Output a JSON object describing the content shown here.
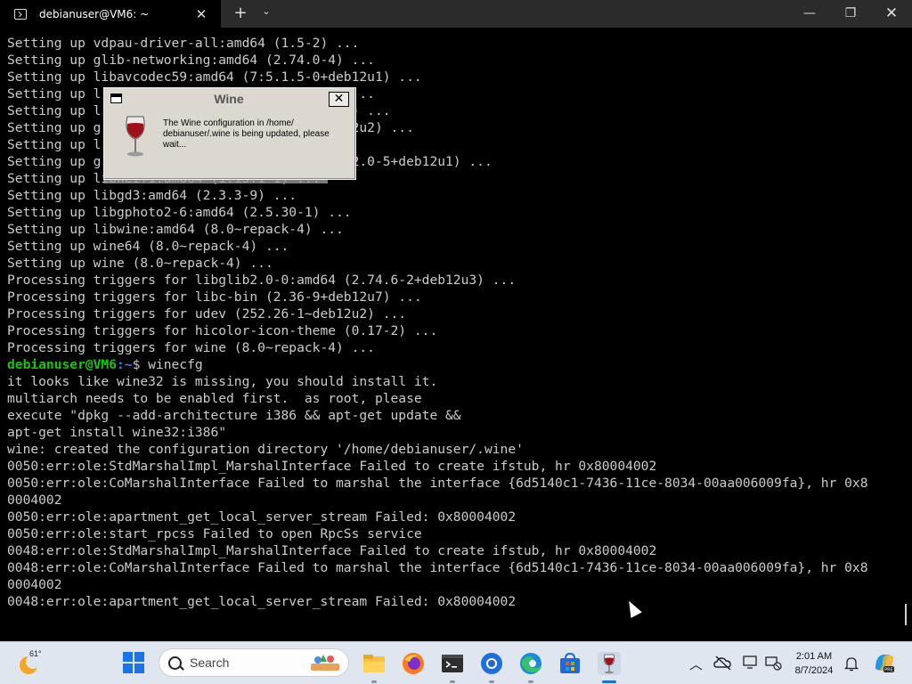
{
  "window": {
    "tab_title": "debianuser@VM6: ~",
    "tab_close": "✕",
    "new_tab": "+",
    "dropdown": "⌄",
    "minimize": "—",
    "maximize": "❐",
    "close": "✕"
  },
  "terminal": {
    "lines_before_prompt": [
      "Setting up vdpau-driver-all:amd64 (1.5-2) ...",
      "Setting up glib-networking:amd64 (2.74.0-4) ...",
      "Setting up libavcodec59:amd64 (7:5.1.5-0+deb12u1) ...",
      "Setting up l                             1) ...",
      "Setting up l                             1-1) ...",
      "Setting up g                             eb12u2) ...",
      "Setting up l",
      "Setting up g                             1.22.0-5+deb12u1) ...",
      "Setting up libheif1:amd64 (1.15.1-1) ...",
      "Setting up libgd3:amd64 (2.3.3-9) ...",
      "Setting up libgphoto2-6:amd64 (2.5.30-1) ...",
      "Setting up libwine:amd64 (8.0~repack-4) ...",
      "Setting up wine64 (8.0~repack-4) ...",
      "Setting up wine (8.0~repack-4) ...",
      "Processing triggers for libglib2.0-0:amd64 (2.74.6-2+deb12u3) ...",
      "Processing triggers for libc-bin (2.36-9+deb12u7) ...",
      "Processing triggers for udev (252.26-1~deb12u2) ...",
      "Processing triggers for hicolor-icon-theme (0.17-2) ...",
      "Processing triggers for wine (8.0~repack-4) ..."
    ],
    "prompt_user": "debianuser@VM6",
    "prompt_path": ":~",
    "prompt_command": "$ winecfg",
    "lines_after_prompt": [
      "it looks like wine32 is missing, you should install it.",
      "multiarch needs to be enabled first.  as root, please",
      "execute \"dpkg --add-architecture i386 && apt-get update &&",
      "apt-get install wine32:i386\"",
      "wine: created the configuration directory '/home/debianuser/.wine'",
      "0050:err:ole:StdMarshalImpl_MarshalInterface Failed to create ifstub, hr 0x80004002",
      "0050:err:ole:CoMarshalInterface Failed to marshal the interface {6d5140c1-7436-11ce-8034-00aa006009fa}, hr 0x8",
      "0004002",
      "0050:err:ole:apartment_get_local_server_stream Failed: 0x80004002",
      "0050:err:ole:start_rpcss Failed to open RpcSs service",
      "0048:err:ole:StdMarshalImpl_MarshalInterface Failed to create ifstub, hr 0x80004002",
      "0048:err:ole:CoMarshalInterface Failed to marshal the interface {6d5140c1-7436-11ce-8034-00aa006009fa}, hr 0x8",
      "0004002",
      "0048:err:ole:apartment_get_local_server_stream Failed: 0x80004002"
    ]
  },
  "wine_dialog": {
    "title": "Wine",
    "close": "✕",
    "message": "The Wine configuration in /home/ debianuser/.wine is being updated, please wait..."
  },
  "taskbar": {
    "weather_temp": "61°",
    "search_placeholder": "Search",
    "clock_time": "2:01 AM",
    "clock_date": "8/7/2024",
    "icons": [
      "file-explorer-icon",
      "firefox-icon",
      "terminal-icon",
      "chrome-icon",
      "edge-icon",
      "store-icon",
      "wine-icon"
    ],
    "tray_icons": [
      "chevron-up-icon",
      "onedrive-icon",
      "display-icon",
      "network-icon",
      "notification-bell-icon",
      "copilot-icon"
    ],
    "colors": {
      "taskbar_bg": "#dfe6ef",
      "accent": "#1a6fd6"
    }
  }
}
